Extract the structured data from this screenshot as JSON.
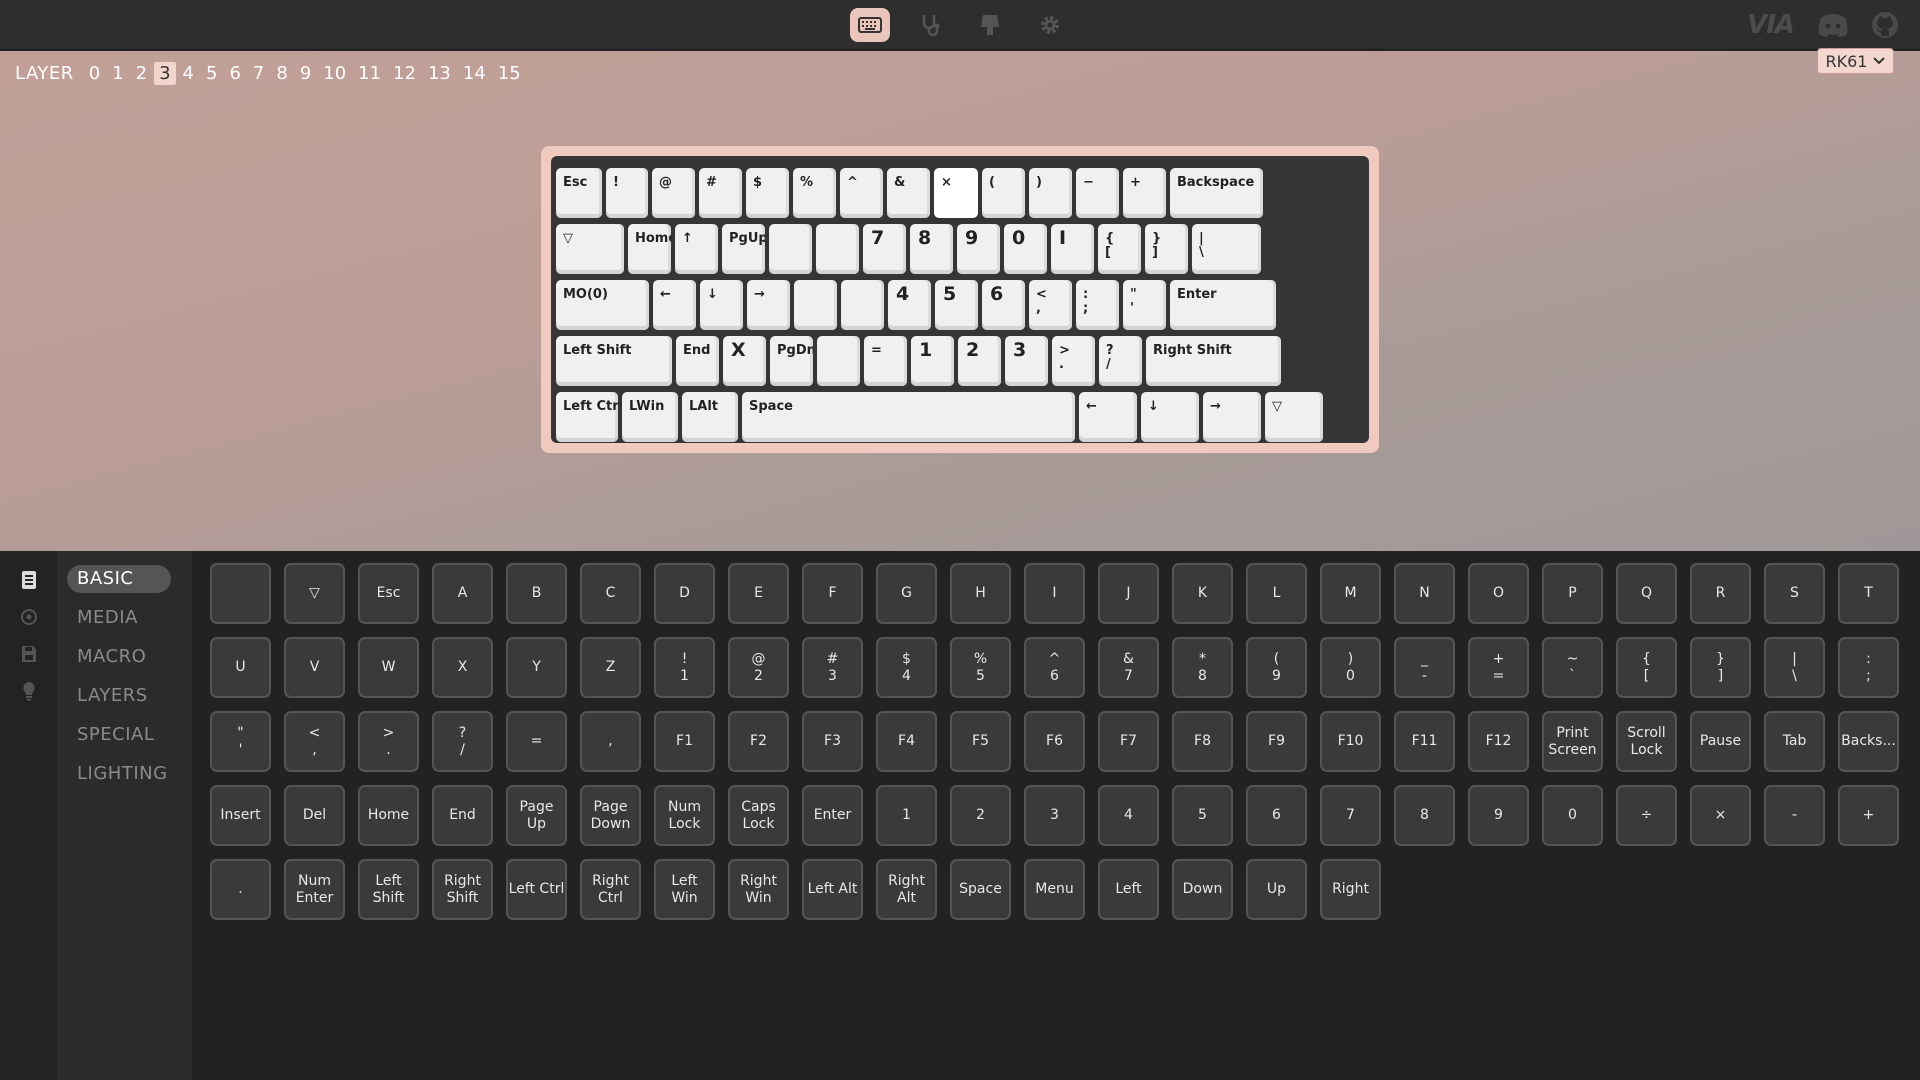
{
  "topnav": {
    "icons": [
      "keyboard-icon",
      "stethoscope-icon",
      "keycap-icon",
      "gear-icon"
    ],
    "brand": "VIA"
  },
  "layers": {
    "label": "LAYER",
    "items": [
      "0",
      "1",
      "2",
      "3",
      "4",
      "5",
      "6",
      "7",
      "8",
      "9",
      "10",
      "11",
      "12",
      "13",
      "14",
      "15"
    ],
    "active": "3"
  },
  "device": {
    "name": "RK61"
  },
  "keyboard": {
    "rows": [
      [
        {
          "t": "Esc"
        },
        {
          "t": "!"
        },
        {
          "t": "@"
        },
        {
          "t": "#"
        },
        {
          "t": "$"
        },
        {
          "t": "%"
        },
        {
          "t": "^"
        },
        {
          "t": "&"
        },
        {
          "t": "×",
          "sel": true
        },
        {
          "t": "("
        },
        {
          "t": ")"
        },
        {
          "t": "−"
        },
        {
          "t": "+"
        },
        {
          "t": "Backspace"
        }
      ],
      [
        {
          "t": "▽"
        },
        {
          "t": "Home"
        },
        {
          "t": "↑"
        },
        {
          "t": "PgUp"
        },
        {
          "t": ""
        },
        {
          "t": ""
        },
        {
          "t": "7",
          "big": true
        },
        {
          "t": "8",
          "big": true
        },
        {
          "t": "9",
          "big": true
        },
        {
          "t": "0",
          "big": true
        },
        {
          "t": "I",
          "big": true
        },
        {
          "t": "{",
          "b": "["
        },
        {
          "t": "}",
          "b": "]"
        },
        {
          "t": "|",
          "b": "\\"
        }
      ],
      [
        {
          "t": "MO(0)"
        },
        {
          "t": "←"
        },
        {
          "t": "↓"
        },
        {
          "t": "→"
        },
        {
          "t": ""
        },
        {
          "t": ""
        },
        {
          "t": "4",
          "big": true
        },
        {
          "t": "5",
          "big": true
        },
        {
          "t": "6",
          "big": true
        },
        {
          "t": "<",
          "b": ","
        },
        {
          "t": ":",
          "b": ";"
        },
        {
          "t": "\"",
          "b": "'"
        },
        {
          "t": "Enter"
        }
      ],
      [
        {
          "t": "Left Shift"
        },
        {
          "t": "End"
        },
        {
          "t": "X",
          "big": true
        },
        {
          "t": "PgDn"
        },
        {
          "t": ""
        },
        {
          "t": "="
        },
        {
          "t": "1",
          "big": true
        },
        {
          "t": "2",
          "big": true
        },
        {
          "t": "3",
          "big": true
        },
        {
          "t": ">",
          "b": "."
        },
        {
          "t": "?",
          "b": "/"
        },
        {
          "t": "Right Shift"
        }
      ],
      [
        {
          "t": "Left Ctrl"
        },
        {
          "t": "LWin"
        },
        {
          "t": "LAlt"
        },
        {
          "t": "Space"
        },
        {
          "t": "←"
        },
        {
          "t": "↓"
        },
        {
          "t": "→"
        },
        {
          "t": "▽"
        }
      ]
    ]
  },
  "categories": {
    "items": [
      "BASIC",
      "MEDIA",
      "MACRO",
      "LAYERS",
      "SPECIAL",
      "LIGHTING"
    ],
    "active": "BASIC"
  },
  "keycodes": {
    "rows": [
      [
        [
          ""
        ],
        [
          "▽"
        ],
        [
          "Esc"
        ],
        [
          "A"
        ],
        [
          "B"
        ],
        [
          "C"
        ],
        [
          "D"
        ],
        [
          "E"
        ],
        [
          "F"
        ],
        [
          "G"
        ],
        [
          "H"
        ],
        [
          "I"
        ],
        [
          "J"
        ],
        [
          "K"
        ],
        [
          "L"
        ],
        [
          "M"
        ],
        [
          "N"
        ],
        [
          "O"
        ],
        [
          "P"
        ],
        [
          "Q"
        ],
        [
          "R"
        ],
        [
          "S"
        ],
        [
          "T"
        ]
      ],
      [
        [
          "U"
        ],
        [
          "V"
        ],
        [
          "W"
        ],
        [
          "X"
        ],
        [
          "Y"
        ],
        [
          "Z"
        ],
        [
          "!",
          "1"
        ],
        [
          "@",
          "2"
        ],
        [
          "#",
          "3"
        ],
        [
          "$",
          "4"
        ],
        [
          "%",
          "5"
        ],
        [
          "^",
          "6"
        ],
        [
          "&",
          "7"
        ],
        [
          "*",
          "8"
        ],
        [
          "(",
          "9"
        ],
        [
          ")",
          "0"
        ],
        [
          "_",
          "-"
        ],
        [
          "+",
          "="
        ],
        [
          "~",
          "`"
        ],
        [
          "{",
          "["
        ],
        [
          "}",
          "]"
        ],
        [
          "|",
          "\\"
        ],
        [
          ":",
          ";"
        ]
      ],
      [
        [
          "\"",
          "'"
        ],
        [
          "<",
          ","
        ],
        [
          ">",
          "."
        ],
        [
          "?",
          "/"
        ],
        [
          "="
        ],
        [
          ","
        ],
        [
          "F1"
        ],
        [
          "F2"
        ],
        [
          "F3"
        ],
        [
          "F4"
        ],
        [
          "F5"
        ],
        [
          "F6"
        ],
        [
          "F7"
        ],
        [
          "F8"
        ],
        [
          "F9"
        ],
        [
          "F10"
        ],
        [
          "F11"
        ],
        [
          "F12"
        ],
        [
          "Print",
          "Screen"
        ],
        [
          "Scroll",
          "Lock"
        ],
        [
          "Pause"
        ],
        [
          "Tab"
        ],
        [
          "Backs..."
        ]
      ],
      [
        [
          "Insert"
        ],
        [
          "Del"
        ],
        [
          "Home"
        ],
        [
          "End"
        ],
        [
          "Page",
          "Up"
        ],
        [
          "Page",
          "Down"
        ],
        [
          "Num",
          "Lock"
        ],
        [
          "Caps",
          "Lock"
        ],
        [
          "Enter"
        ],
        [
          "1"
        ],
        [
          "2"
        ],
        [
          "3"
        ],
        [
          "4"
        ],
        [
          "5"
        ],
        [
          "6"
        ],
        [
          "7"
        ],
        [
          "8"
        ],
        [
          "9"
        ],
        [
          "0"
        ],
        [
          "÷"
        ],
        [
          "×"
        ],
        [
          "-"
        ],
        [
          "+"
        ]
      ],
      [
        [
          "."
        ],
        [
          "Num",
          "Enter"
        ],
        [
          "Left",
          "Shift"
        ],
        [
          "Right",
          "Shift"
        ],
        [
          "Left Ctrl"
        ],
        [
          "Right",
          "Ctrl"
        ],
        [
          "Left",
          "Win"
        ],
        [
          "Right",
          "Win"
        ],
        [
          "Left Alt"
        ],
        [
          "Right",
          "Alt"
        ],
        [
          "Space"
        ],
        [
          "Menu"
        ],
        [
          "Left"
        ],
        [
          "Down"
        ],
        [
          "Up"
        ],
        [
          "Right"
        ]
      ]
    ]
  }
}
